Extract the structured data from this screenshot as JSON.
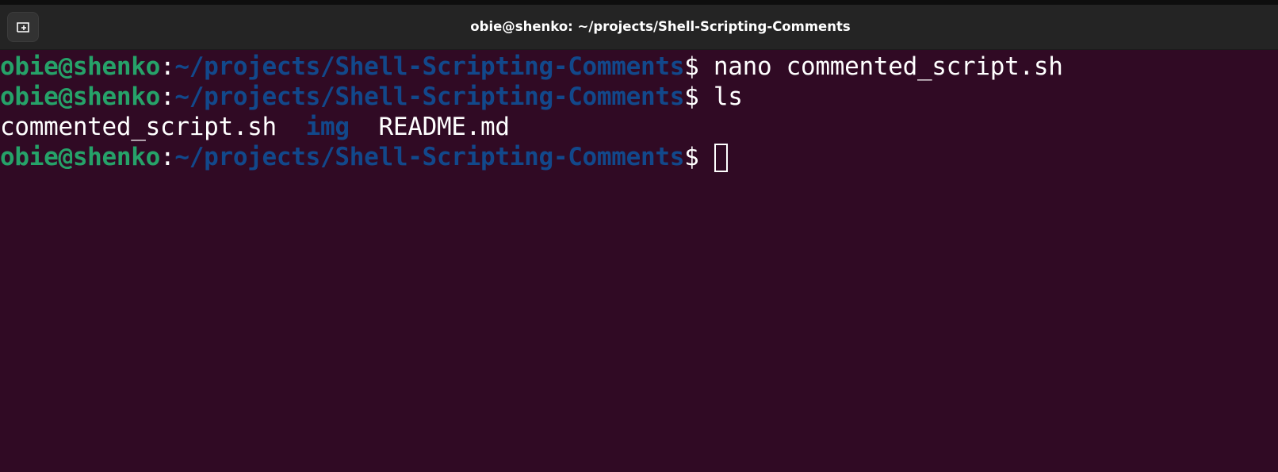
{
  "window": {
    "title": "obie@shenko: ~/projects/Shell-Scripting-Comments",
    "new_tab_icon": "new-tab-icon"
  },
  "prompt": {
    "user_host": "obie@shenko",
    "colon": ":",
    "path": "~/projects/Shell-Scripting-Comments",
    "dollar": "$"
  },
  "lines": [
    {
      "type": "prompt",
      "command": " nano commented_script.sh"
    },
    {
      "type": "prompt",
      "command": " ls"
    },
    {
      "type": "output",
      "items": [
        {
          "text": "commented_script.sh",
          "kind": "file"
        },
        {
          "text": "img",
          "kind": "directory"
        },
        {
          "text": "README.md",
          "kind": "file"
        }
      ]
    },
    {
      "type": "prompt",
      "command": " "
    }
  ],
  "colors": {
    "background": "#300a24",
    "user_host": "#26a269",
    "path": "#12488b",
    "directory": "#12488b",
    "text": "#ffffff",
    "titlebar": "#242424"
  }
}
